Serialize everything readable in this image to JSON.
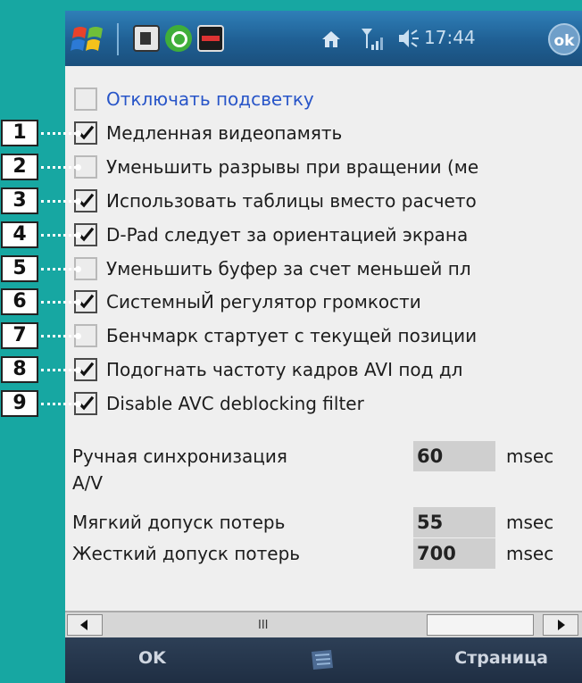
{
  "statusbar": {
    "time": "17:44",
    "ok_label": "ok"
  },
  "options": [
    {
      "label": "Отключать подсветку",
      "checked": false,
      "style": "link"
    },
    {
      "label": "Медленная видеопамять",
      "checked": true
    },
    {
      "label": "Уменьшить разрывы при вращении (ме",
      "checked": false
    },
    {
      "label": "Использовать таблицы вместо расчето",
      "checked": true
    },
    {
      "label": "D-Pad следует за ориентацией экрана",
      "checked": true
    },
    {
      "label": "Уменьшить буфер за счет меньшей пл",
      "checked": false
    },
    {
      "label": "СистемныЙ регулятор громкости",
      "checked": true
    },
    {
      "label": "Бенчмарк стартует с текущей позиции",
      "checked": false
    },
    {
      "label": "Подогнать частоту кадров AVI под дл",
      "checked": true
    },
    {
      "label": "Disable AVC deblocking filter",
      "checked": true
    }
  ],
  "badges": [
    "1",
    "2",
    "3",
    "4",
    "5",
    "6",
    "7",
    "8",
    "9"
  ],
  "settings": [
    {
      "label_line1": "Ручная синхронизация",
      "label_line2": "A/V",
      "value": "60",
      "unit": "msec"
    },
    {
      "label_line1": "Мягкий допуск потерь",
      "value": "55",
      "unit": "msec"
    },
    {
      "label_line1": "Жесткий допуск потерь",
      "value": "700",
      "unit": "msec"
    }
  ],
  "menubar": {
    "left": "OK",
    "right": "Страница"
  },
  "icons": {
    "start": "windows-flag-icon",
    "home": "home-icon",
    "signal": "signal-icon",
    "volume": "speaker-icon",
    "keyboard": "keyboard-icon"
  }
}
